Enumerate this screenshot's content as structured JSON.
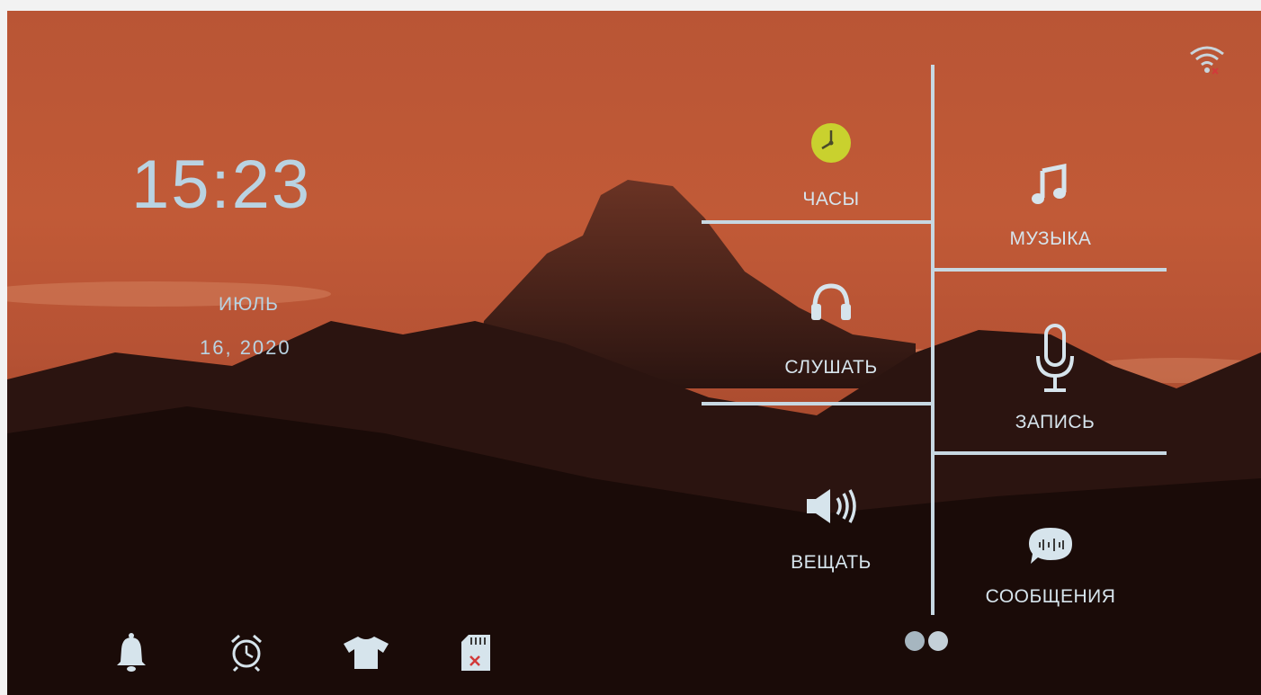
{
  "clock": {
    "time": "15:23",
    "month": "ИЮЛЬ",
    "day_year": "16, 2020"
  },
  "tiles": {
    "clock": "ЧАСЫ",
    "music": "МУЗЫКА",
    "listen": "СЛУШАТЬ",
    "record": "ЗАПИСЬ",
    "broadcast": "ВЕЩАТЬ",
    "messages": "СООБЩЕНИЯ"
  },
  "icons": {
    "status": [
      "wifi-disconnected-icon"
    ],
    "tiles": [
      "clock-icon",
      "music-note-icon",
      "headphones-icon",
      "microphone-icon",
      "speaker-icon",
      "chat-bubble-icon"
    ],
    "bottom_bar": [
      "bell-icon",
      "alarm-clock-icon",
      "shirt-icon",
      "sd-card-error-icon"
    ]
  },
  "pager": {
    "pages": 2
  },
  "colors": {
    "text": "#d6e4ec",
    "clock_icon": "#c9d12e",
    "sd_error": "#d23a3a"
  }
}
